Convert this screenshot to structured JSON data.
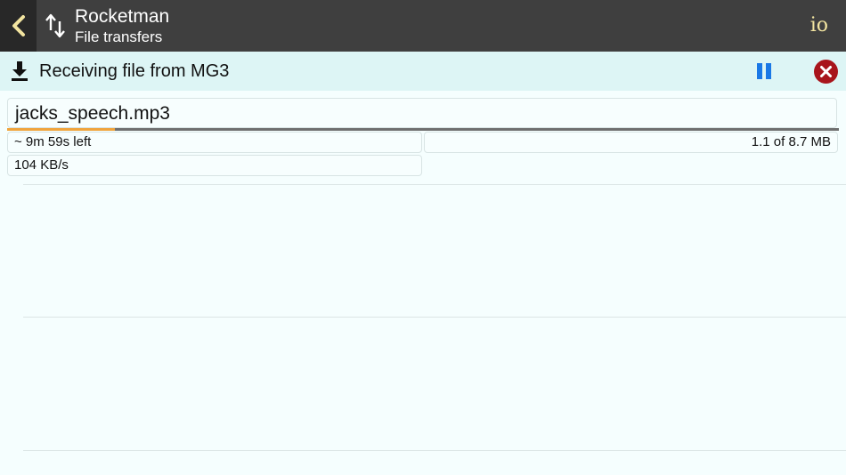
{
  "header": {
    "title": "Rocketman",
    "subtitle": "File transfers",
    "logo_text": "io",
    "back_icon": "chevron-left-icon",
    "transfer_icon": "arrows-up-down-icon"
  },
  "status": {
    "message": "Receiving file from MG3",
    "download_icon": "download-icon",
    "pause_icon": "pause-icon",
    "cancel_icon": "close-circle-icon"
  },
  "transfer": {
    "file_name": "jacks_speech.mp3",
    "time_left": "~ 9m 59s left",
    "size": "1.1 of 8.7 MB",
    "speed": "104 KB/s",
    "progress_fraction": 0.13
  },
  "colors": {
    "header_bg": "#3f3f3f",
    "status_bg": "#ddf5f5",
    "accent_back": "#f2e4a0",
    "pause": "#1a78e6",
    "cancel": "#a8141b",
    "progress": "#f0a43c"
  }
}
